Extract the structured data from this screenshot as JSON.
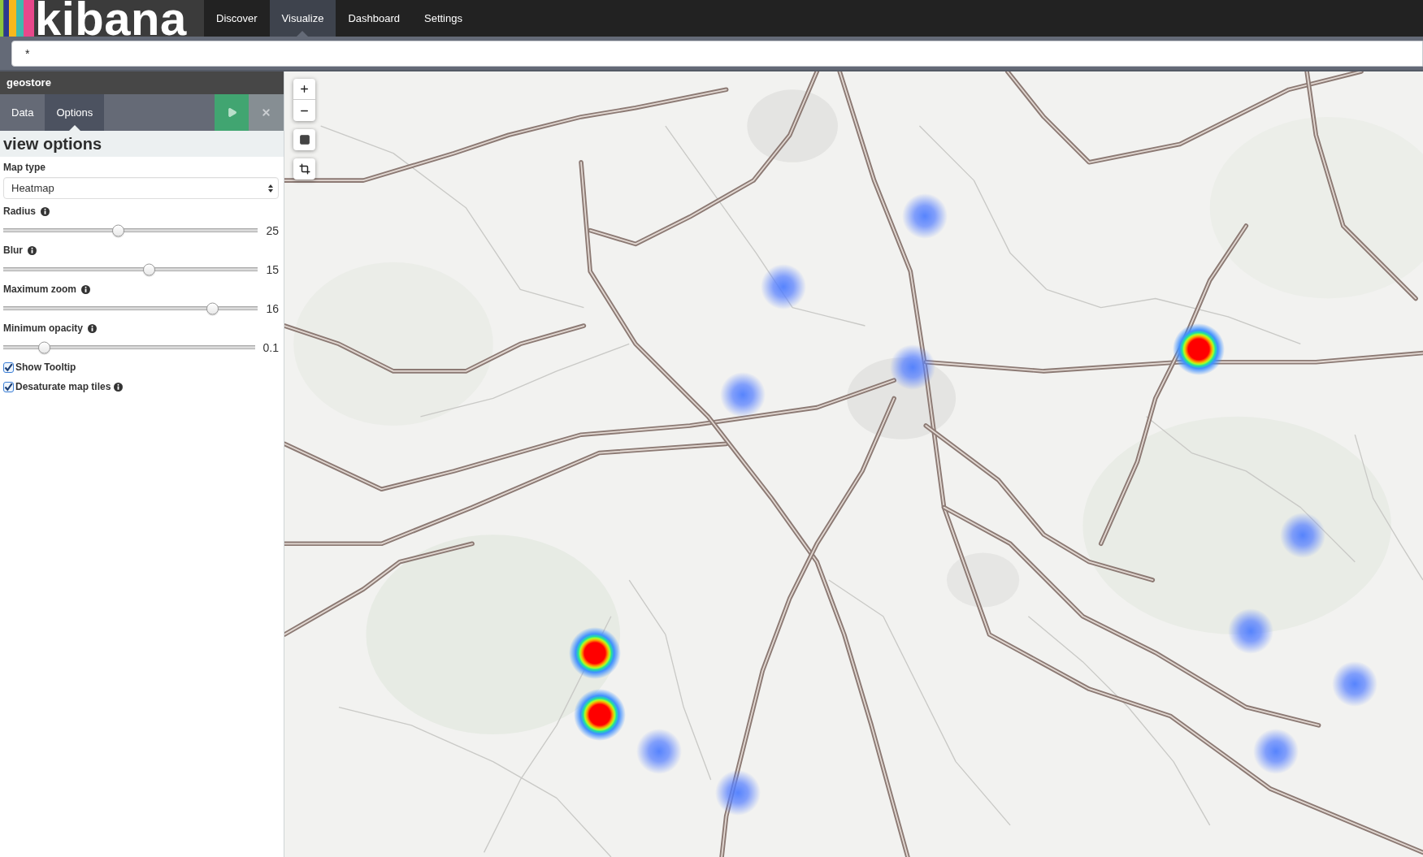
{
  "nav": {
    "logo": "kibana",
    "tabs": [
      {
        "label": "Discover",
        "selected": false
      },
      {
        "label": "Visualize",
        "selected": true
      },
      {
        "label": "Dashboard",
        "selected": false
      },
      {
        "label": "Settings",
        "selected": false
      }
    ]
  },
  "search": {
    "value": "*"
  },
  "sidebar": {
    "title": "geostore",
    "tabs": [
      {
        "label": "Data",
        "selected": false
      },
      {
        "label": "Options",
        "selected": true
      }
    ],
    "heading": "view options",
    "map_type": {
      "label": "Map type",
      "value": "Heatmap"
    },
    "sliders": [
      {
        "label": "Radius",
        "level": 0.45,
        "reading": "25"
      },
      {
        "label": "Blur",
        "level": 0.57,
        "reading": "15"
      },
      {
        "label": "Maximum zoom",
        "level": 0.82,
        "reading": "16"
      },
      {
        "label": "Minimum opacity",
        "level": 0.16,
        "reading": "0.1"
      }
    ],
    "checkboxes": [
      {
        "label": "Show Tooltip",
        "checked": true,
        "info": false
      },
      {
        "label": "Desaturate map tiles",
        "checked": true,
        "info": true
      }
    ]
  }
}
